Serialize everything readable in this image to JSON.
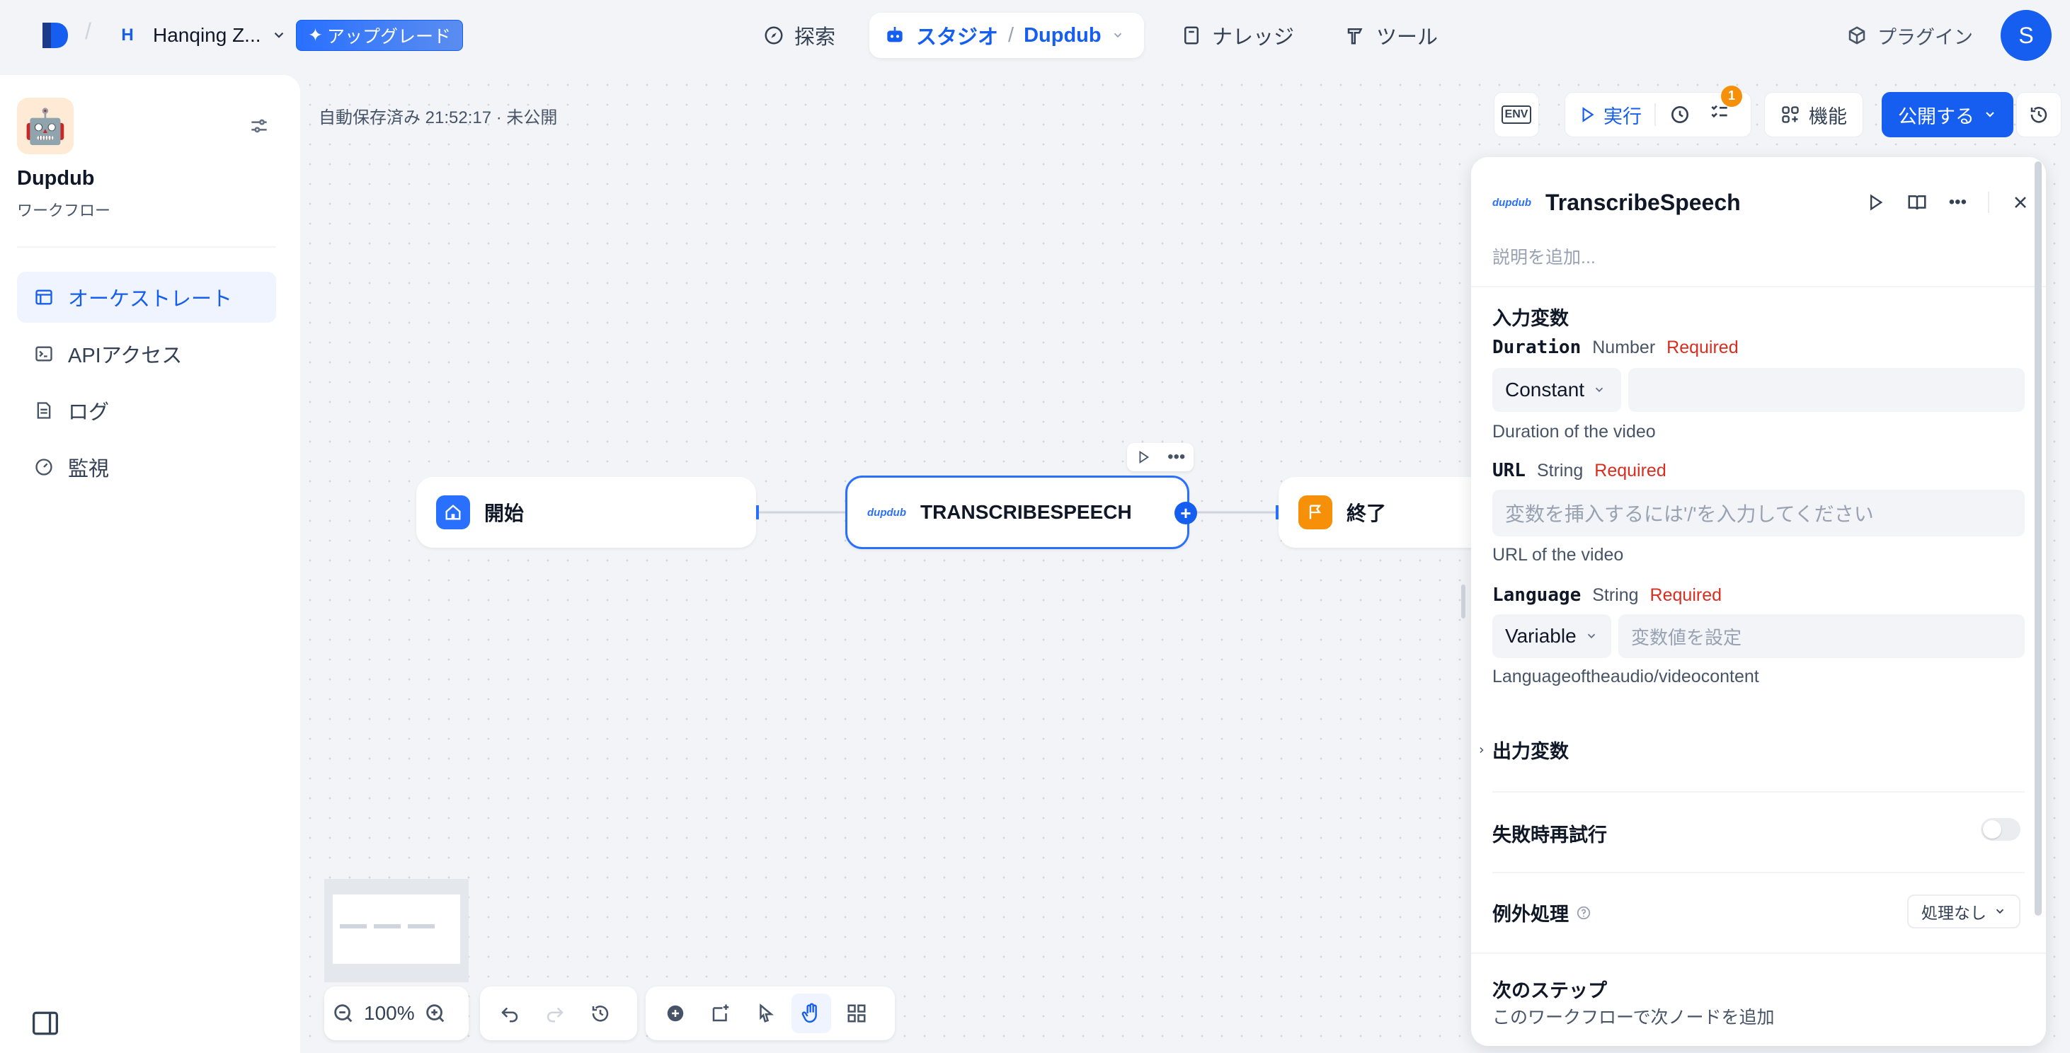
{
  "topbar": {
    "workspace_initial": "H",
    "workspace_name": "Hanqing Z...",
    "upgrade_label": "アップグレード",
    "nav_explore": "探索",
    "nav_studio": "スタジオ",
    "nav_studio_app": "Dupdub",
    "nav_knowledge": "ナレッジ",
    "nav_tools": "ツール",
    "plugins_label": "プラグイン",
    "avatar_initial": "S"
  },
  "sidebar": {
    "app_name": "Dupdub",
    "app_type": "ワークフロー",
    "items": [
      {
        "label": "オーケストレート",
        "icon": "window-icon"
      },
      {
        "label": "APIアクセス",
        "icon": "terminal-icon"
      },
      {
        "label": "ログ",
        "icon": "document-icon"
      },
      {
        "label": "監視",
        "icon": "gauge-icon"
      }
    ]
  },
  "canvas": {
    "autosave": "自動保存済み 21:52:17 · 未公開",
    "env_label": "ENV",
    "run_label": "実行",
    "checklist_badge": "1",
    "features_label": "機能",
    "publish_label": "公開する",
    "zoom_level": "100%",
    "nodes": {
      "start": "開始",
      "transcribe": "TRANSCRIBESPEECH",
      "end": "終了"
    }
  },
  "panel": {
    "title": "TranscribeSpeech",
    "desc_placeholder": "説明を追加...",
    "input_section": "入力変数",
    "vars": [
      {
        "name": "Duration",
        "type": "Number",
        "required": "Required",
        "mode": "Constant",
        "placeholder": "",
        "desc": "Duration of the video"
      },
      {
        "name": "URL",
        "type": "String",
        "required": "Required",
        "placeholder": "変数を挿入するには'/'を入力してください",
        "desc": "URL of the video"
      },
      {
        "name": "Language",
        "type": "String",
        "required": "Required",
        "mode": "Variable",
        "placeholder": "変数値を設定",
        "desc": "Languageoftheaudio/videocontent"
      }
    ],
    "output_section": "出力変数",
    "retry_label": "失敗時再試行",
    "exception_label": "例外処理",
    "exception_value": "処理なし",
    "next_step_title": "次のステップ",
    "next_step_desc": "このワークフローで次ノードを追加"
  },
  "colors": {
    "accent": "#155eef",
    "start_node": "#2970ff",
    "end_node": "#f79009",
    "required": "#d92d20"
  }
}
